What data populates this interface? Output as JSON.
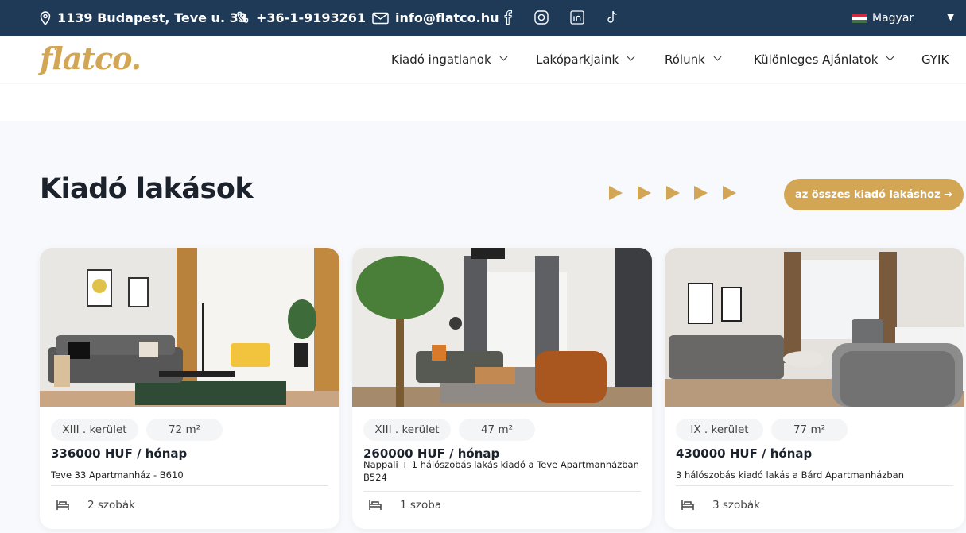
{
  "topbar": {
    "address": "1139 Budapest, Teve u. 33",
    "phone": "+36-1-9193261",
    "email": "info@flatco.hu",
    "social_icons": [
      "facebook-icon",
      "instagram-icon",
      "linkedin-icon",
      "tiktok-icon"
    ],
    "language": "Magyar"
  },
  "nav": {
    "logo": "flatco.",
    "items": [
      {
        "label": "Kiadó ingatlanok",
        "has_dropdown": true
      },
      {
        "label": "Lakóparkjaink",
        "has_dropdown": true
      },
      {
        "label": "Rólunk",
        "has_dropdown": true
      },
      {
        "label": "Különleges Ajánlatok",
        "has_dropdown": true
      },
      {
        "label": "GYIK",
        "has_dropdown": false
      }
    ]
  },
  "section": {
    "title": "Kiadó lakások",
    "cta_label": "az összes kiadó lakáshoz →"
  },
  "listings": [
    {
      "district": "XIII . kerület",
      "area": "72 m²",
      "price": "336000 HUF / hónap",
      "description": "Teve 33 Apartmanház - B610",
      "rooms": "2 szobák"
    },
    {
      "district": "XIII . kerület",
      "area": "47 m²",
      "price": "260000 HUF / hónap",
      "description": "Nappali + 1 hálószobás lakás kiadó a Teve Apartmanházban B524",
      "rooms": "1 szoba"
    },
    {
      "district": "IX . kerület",
      "area": "77 m²",
      "price": "430000 HUF / hónap",
      "description": "3 hálószobás kiadó lakás a Bárd Apartmanházban",
      "rooms": "3 szobák"
    }
  ],
  "colors": {
    "topbar_bg": "#1f3a57",
    "accent_gold": "#d3a655",
    "page_bg": "#f7f9fc"
  }
}
